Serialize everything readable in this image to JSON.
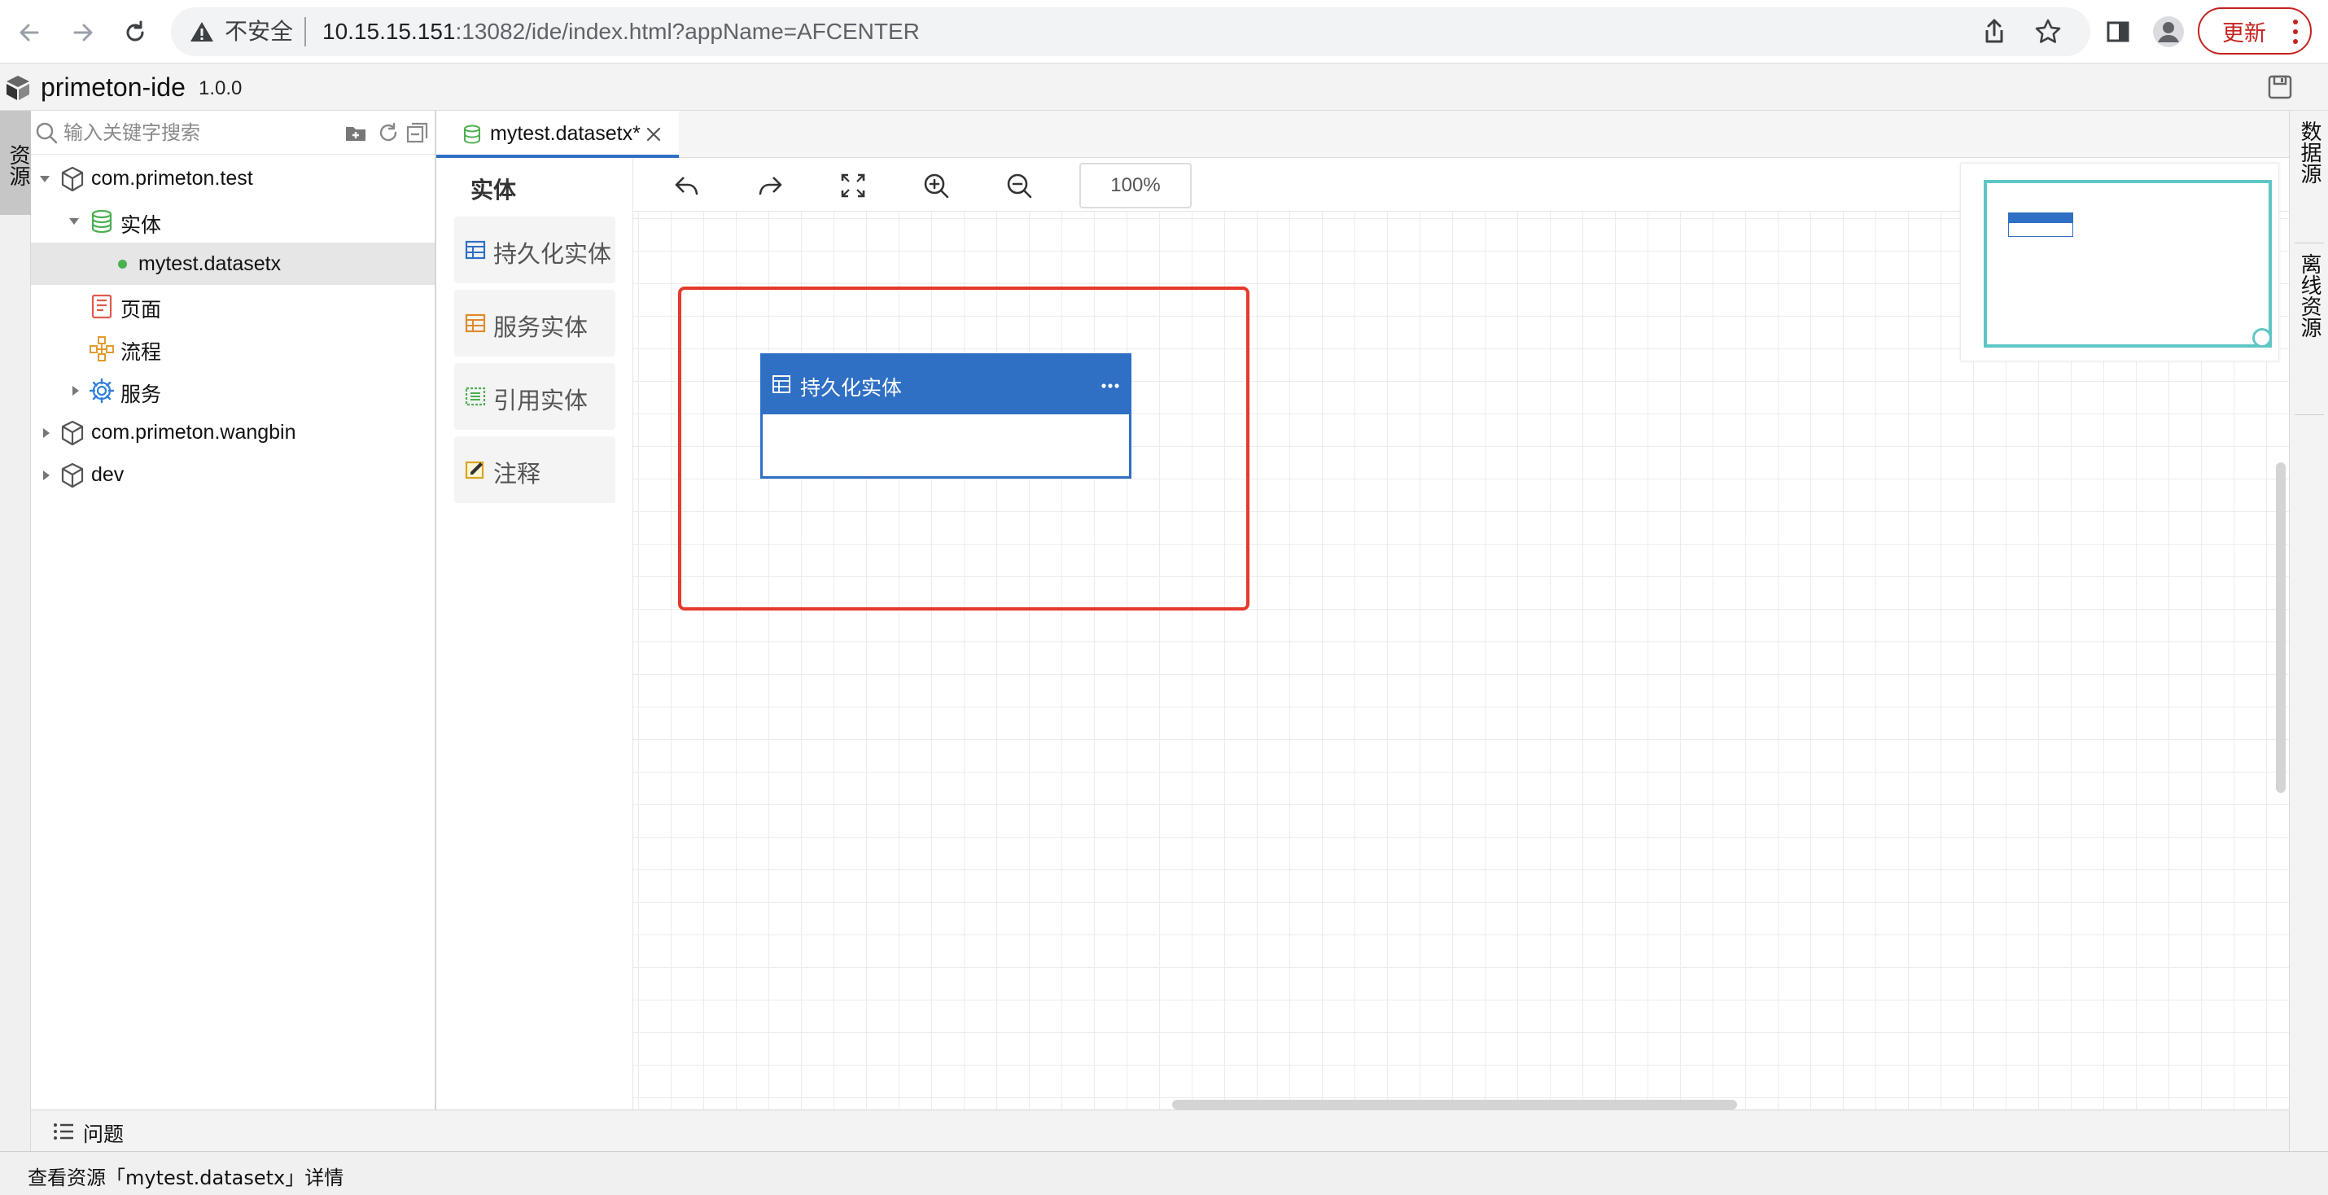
{
  "browser": {
    "security_label": "不安全",
    "url_host": "10.15.15.151",
    "url_rest": ":13082/ide/index.html?appName=AFCENTER",
    "update_label": "更新"
  },
  "app": {
    "title": "primeton-ide",
    "version": "1.0.0"
  },
  "left_rail": {
    "tab_label": "资源"
  },
  "tree": {
    "search_placeholder": "输入关键字搜索",
    "items": [
      {
        "label": "com.primeton.test",
        "icon": "package-icon",
        "expanded": true
      },
      {
        "label": "实体",
        "icon": "database-icon",
        "expanded": true
      },
      {
        "label": "mytest.datasetx",
        "icon": "dot-icon",
        "selected": true
      },
      {
        "label": "页面",
        "icon": "page-icon"
      },
      {
        "label": "流程",
        "icon": "flow-icon"
      },
      {
        "label": "服务",
        "icon": "gear-icon",
        "expanded": false
      },
      {
        "label": "com.primeton.wangbin",
        "icon": "package-icon",
        "expanded": false
      },
      {
        "label": "dev",
        "icon": "package-icon",
        "expanded": false
      }
    ]
  },
  "editor": {
    "tab_label": "mytest.datasetx*",
    "zoom": "100%"
  },
  "palette": {
    "title": "实体",
    "items": [
      {
        "label": "持久化实体",
        "icon": "persistent-entity-icon",
        "color": "#2f6fc4"
      },
      {
        "label": "服务实体",
        "icon": "service-entity-icon",
        "color": "#e08a2b"
      },
      {
        "label": "引用实体",
        "icon": "reference-entity-icon",
        "color": "#4caf50"
      },
      {
        "label": "注释",
        "icon": "note-icon",
        "color": "#d9a521"
      }
    ]
  },
  "canvas": {
    "node_title": "持久化实体",
    "accent_color": "#2f6fc4",
    "selection_color": "#e5392c"
  },
  "right_rail": {
    "tabs": [
      "数据源",
      "离线资源"
    ]
  },
  "problems": {
    "label": "问题"
  },
  "status": {
    "text": "查看资源「mytest.datasetx」详情"
  }
}
